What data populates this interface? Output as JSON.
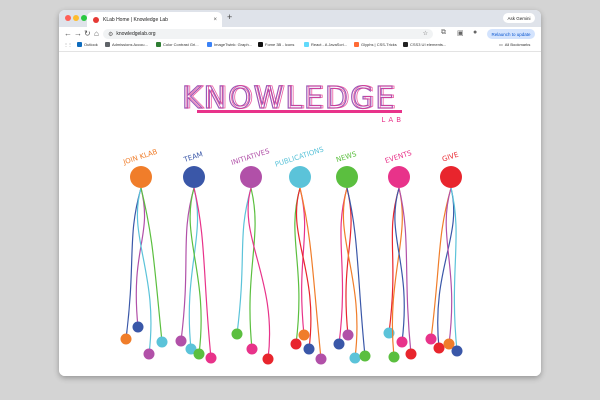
{
  "browser": {
    "tab_title": "KLab Home | Knowledge Lab",
    "tab_close": "×",
    "new_tab": "+",
    "ask_gemini": "Ask Gemini",
    "url": "knowledgelab.org",
    "relaunch": "Relaunch to update",
    "nav_back": "←",
    "nav_forward": "→",
    "nav_reload": "↻",
    "nav_home": "⌂",
    "bookmarks": [
      {
        "label": "Outlook",
        "color": "#0f6cbd"
      },
      {
        "label": "Admissions Accou...",
        "color": "#5f6368"
      },
      {
        "label": "Color Contrast Gri...",
        "color": "#2e7d32"
      },
      {
        "label": "ImageTwink: Graph...",
        "color": "#3b82f6"
      },
      {
        "label": "Fome 3B - Icons",
        "color": "#111111"
      },
      {
        "label": "React - A JavaScri...",
        "color": "#61dafb"
      },
      {
        "label": "Glyphs | CSS-Tricks",
        "color": "#ff6b35"
      },
      {
        "label": "CSS3 UI elements...",
        "color": "#222222"
      }
    ],
    "all_bookmarks": "All Bookmarks"
  },
  "site": {
    "logo_text": "KNOWLEDGE",
    "logo_sub": "LAB",
    "menu": [
      {
        "label": "JOIN KLAB",
        "color": "#f07d2a"
      },
      {
        "label": "TEAM",
        "color": "#3a57a8"
      },
      {
        "label": "INITIATIVES",
        "color": "#b150a8"
      },
      {
        "label": "PUBLICATIONS",
        "color": "#5bc3d9"
      },
      {
        "label": "NEWS",
        "color": "#5bbf3f"
      },
      {
        "label": "EVENTS",
        "color": "#e8338a"
      },
      {
        "label": "GIVE",
        "color": "#e8252d"
      }
    ]
  }
}
